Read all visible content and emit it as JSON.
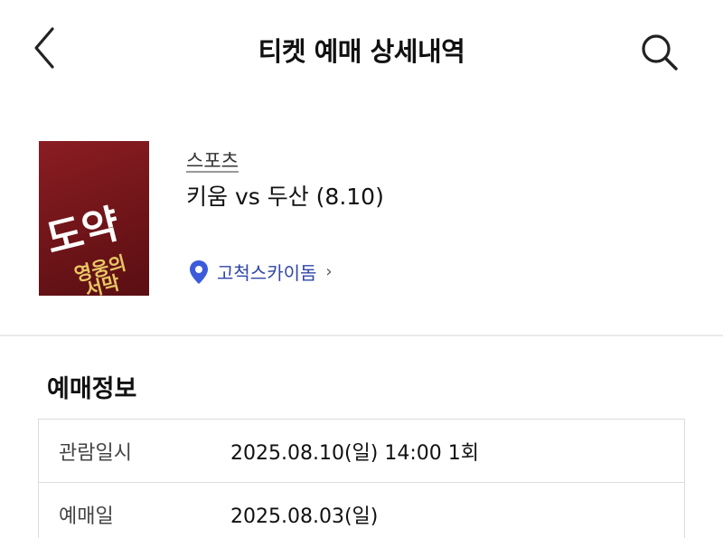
{
  "header": {
    "title": "티켓 예매 상세내역",
    "back_icon": "chevron-left-icon",
    "search_icon": "search-icon"
  },
  "event": {
    "poster_text": "도약 영웅의 서막",
    "category": "스포츠",
    "title": "키움 vs 두산 (8.10)",
    "venue": "고척스카이돔",
    "venue_chevron": "›",
    "venue_icon_color": "#3b5bdb"
  },
  "booking_info": {
    "title": "예매정보",
    "rows": [
      {
        "label": "관람일시",
        "value": "2025.08.10(일) 14:00 1회"
      },
      {
        "label": "예매일",
        "value": "2025.08.03(일)"
      }
    ]
  }
}
